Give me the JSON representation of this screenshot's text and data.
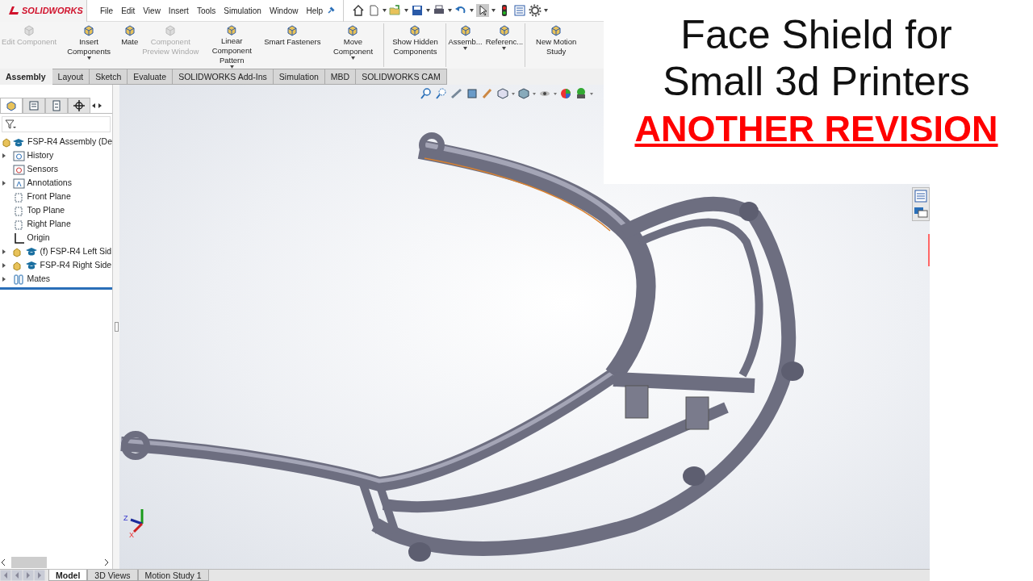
{
  "app": {
    "logo": "SOLIDWORKS"
  },
  "menu": [
    {
      "label": "File"
    },
    {
      "label": "Edit"
    },
    {
      "label": "View"
    },
    {
      "label": "Insert"
    },
    {
      "label": "Tools"
    },
    {
      "label": "Simulation"
    },
    {
      "label": "Window"
    },
    {
      "label": "Help"
    }
  ],
  "command_manager": [
    {
      "label": "Edit Component",
      "disabled": true,
      "dropdown": false,
      "divider_before": false
    },
    {
      "label": "Insert Components",
      "disabled": false,
      "dropdown": true,
      "divider_before": false
    },
    {
      "label": "Mate",
      "disabled": false,
      "dropdown": false,
      "divider_before": false
    },
    {
      "label": "Component Preview Window",
      "disabled": true,
      "dropdown": false,
      "divider_before": false
    },
    {
      "label": "Linear Component Pattern",
      "disabled": false,
      "dropdown": true,
      "divider_before": false
    },
    {
      "label": "Smart Fasteners",
      "disabled": false,
      "dropdown": false,
      "divider_before": false
    },
    {
      "label": "Move Component",
      "disabled": false,
      "dropdown": true,
      "divider_before": false
    },
    {
      "label": "Show Hidden Components",
      "disabled": false,
      "dropdown": false,
      "divider_before": true
    },
    {
      "label": "Assemb...",
      "disabled": false,
      "dropdown": true,
      "divider_before": true
    },
    {
      "label": "Referenc...",
      "disabled": false,
      "dropdown": true,
      "divider_before": false
    },
    {
      "label": "New Motion Study",
      "disabled": false,
      "dropdown": false,
      "divider_before": true
    }
  ],
  "tabs": [
    {
      "label": "Assembly",
      "selected": true
    },
    {
      "label": "Layout",
      "selected": false
    },
    {
      "label": "Sketch",
      "selected": false
    },
    {
      "label": "Evaluate",
      "selected": false
    },
    {
      "label": "SOLIDWORKS Add-Ins",
      "selected": false
    },
    {
      "label": "Simulation",
      "selected": false
    },
    {
      "label": "MBD",
      "selected": false
    },
    {
      "label": "SOLIDWORKS CAM",
      "selected": false
    }
  ],
  "panel_tabs": [
    {
      "kind": "tree",
      "selected": true
    },
    {
      "kind": "property",
      "selected": false
    },
    {
      "kind": "config",
      "selected": false
    },
    {
      "kind": "target",
      "selected": false
    }
  ],
  "tree": {
    "root": "FSP-R4 Assembly  (De",
    "items": [
      {
        "label": "History",
        "kind": "history",
        "expandable": true
      },
      {
        "label": "Sensors",
        "kind": "sensor",
        "expandable": false
      },
      {
        "label": "Annotations",
        "kind": "annotation",
        "expandable": true
      },
      {
        "label": "Front Plane",
        "kind": "plane",
        "expandable": false
      },
      {
        "label": "Top Plane",
        "kind": "plane",
        "expandable": false
      },
      {
        "label": "Right Plane",
        "kind": "plane",
        "expandable": false
      },
      {
        "label": "Origin",
        "kind": "origin",
        "expandable": false
      },
      {
        "label": "(f) FSP-R4 Left Sid",
        "kind": "part",
        "expandable": true
      },
      {
        "label": "FSP-R4 Right Side",
        "kind": "part",
        "expandable": true
      },
      {
        "label": "Mates",
        "kind": "mates",
        "expandable": true
      }
    ]
  },
  "triad": {
    "labels": [
      "Z",
      "X"
    ]
  },
  "bottom_tabs": [
    {
      "label": "Model",
      "selected": true
    },
    {
      "label": "3D Views",
      "selected": false
    },
    {
      "label": "Motion Study 1",
      "selected": false
    }
  ],
  "overlay": {
    "lines": [
      "Face Shield for",
      "Small 3d Printers"
    ],
    "highlight": "ANOTHER REVISION"
  }
}
